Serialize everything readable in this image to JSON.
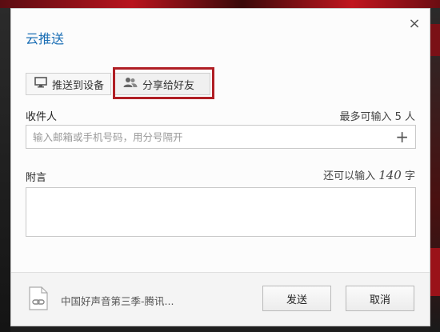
{
  "dialog": {
    "title": "云推送",
    "close_glyph": "×"
  },
  "tabs": [
    {
      "label": "推送到设备",
      "icon": "monitor-icon"
    },
    {
      "label": "分享给好友",
      "icon": "users-icon",
      "highlighted": true
    }
  ],
  "recipients": {
    "label": "收件人",
    "limit_hint": "最多可输入 5 人",
    "placeholder": "输入邮箱或手机号码，用分号隔开",
    "value": "",
    "add_glyph": "+"
  },
  "message": {
    "label": "附言",
    "hint_prefix": "还可以输入 ",
    "remaining": "140",
    "hint_suffix": " 字",
    "value": ""
  },
  "footer": {
    "file_name": "中国好声音第三季-腾讯...",
    "file_icon": "link-file-icon",
    "send_label": "发送",
    "cancel_label": "取消"
  },
  "colors": {
    "title": "#1c6fb5",
    "highlight_border": "#b01e24"
  }
}
